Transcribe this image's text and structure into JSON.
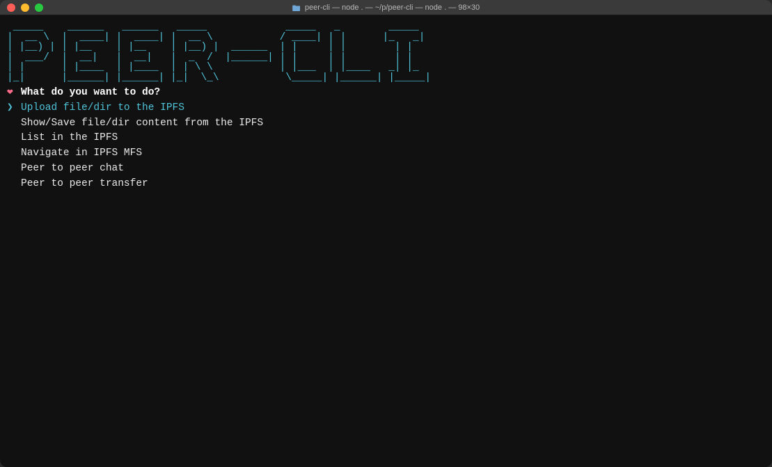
{
  "window": {
    "title": "peer-cli — node . — ~/p/peer-cli — node . — 98×30"
  },
  "ascii_art": " _____    ______   ______   _____             _____   _        _____ \n|  __ \\  |  ____| |  ____| |  __ \\           / ____| | |      |_   _|\n| |__) | | |__    | |__    | |__) |  ______  | |     | |        | |  \n|  ___/  |  __|   |  __|   |  _  /  |______| | |     | |        | |  \n| |      | |____  | |____  | | \\ \\           | |___  | |____   _| |_ \n|_|      |______| |______| |_|  \\_\\           \\_____| |______| |_____|",
  "prompt": {
    "heart": "❤",
    "question": "What do you want to do?"
  },
  "menu": {
    "pointer": "❯",
    "items": [
      {
        "label": "Upload file/dir to the IPFS",
        "selected": true
      },
      {
        "label": "Show/Save file/dir content from the IPFS",
        "selected": false
      },
      {
        "label": "List in the IPFS",
        "selected": false
      },
      {
        "label": "Navigate in IPFS MFS",
        "selected": false
      },
      {
        "label": "Peer to peer chat",
        "selected": false
      },
      {
        "label": "Peer to peer transfer",
        "selected": false
      }
    ]
  }
}
